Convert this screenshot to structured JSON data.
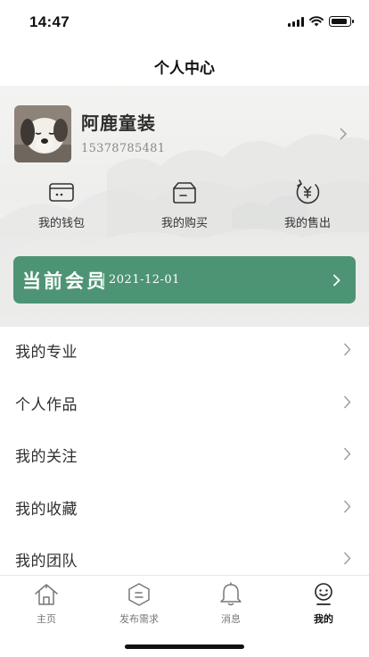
{
  "status_bar": {
    "time": "14:47"
  },
  "nav": {
    "title": "个人中心"
  },
  "profile": {
    "name": "阿鹿童装",
    "phone": "15378785481"
  },
  "quick_actions": [
    {
      "label": "我的钱包",
      "icon": "wallet-icon"
    },
    {
      "label": "我的购买",
      "icon": "box-icon"
    },
    {
      "label": "我的售出",
      "icon": "yen-icon"
    }
  ],
  "membership": {
    "title": "当前会员",
    "date": "2021-12-01"
  },
  "menu": [
    {
      "label": "我的专业"
    },
    {
      "label": "个人作品"
    },
    {
      "label": "我的关注"
    },
    {
      "label": "我的收藏"
    },
    {
      "label": "我的团队"
    }
  ],
  "tabs": [
    {
      "label": "主页",
      "icon": "home-icon",
      "active": false
    },
    {
      "label": "发布需求",
      "icon": "publish-icon",
      "active": false
    },
    {
      "label": "消息",
      "icon": "bell-icon",
      "active": false
    },
    {
      "label": "我的",
      "icon": "user-icon",
      "active": true
    }
  ],
  "colors": {
    "accent": "#4d9474",
    "background": "#ffffff",
    "text": "#2b2b2b",
    "muted": "#888888"
  }
}
